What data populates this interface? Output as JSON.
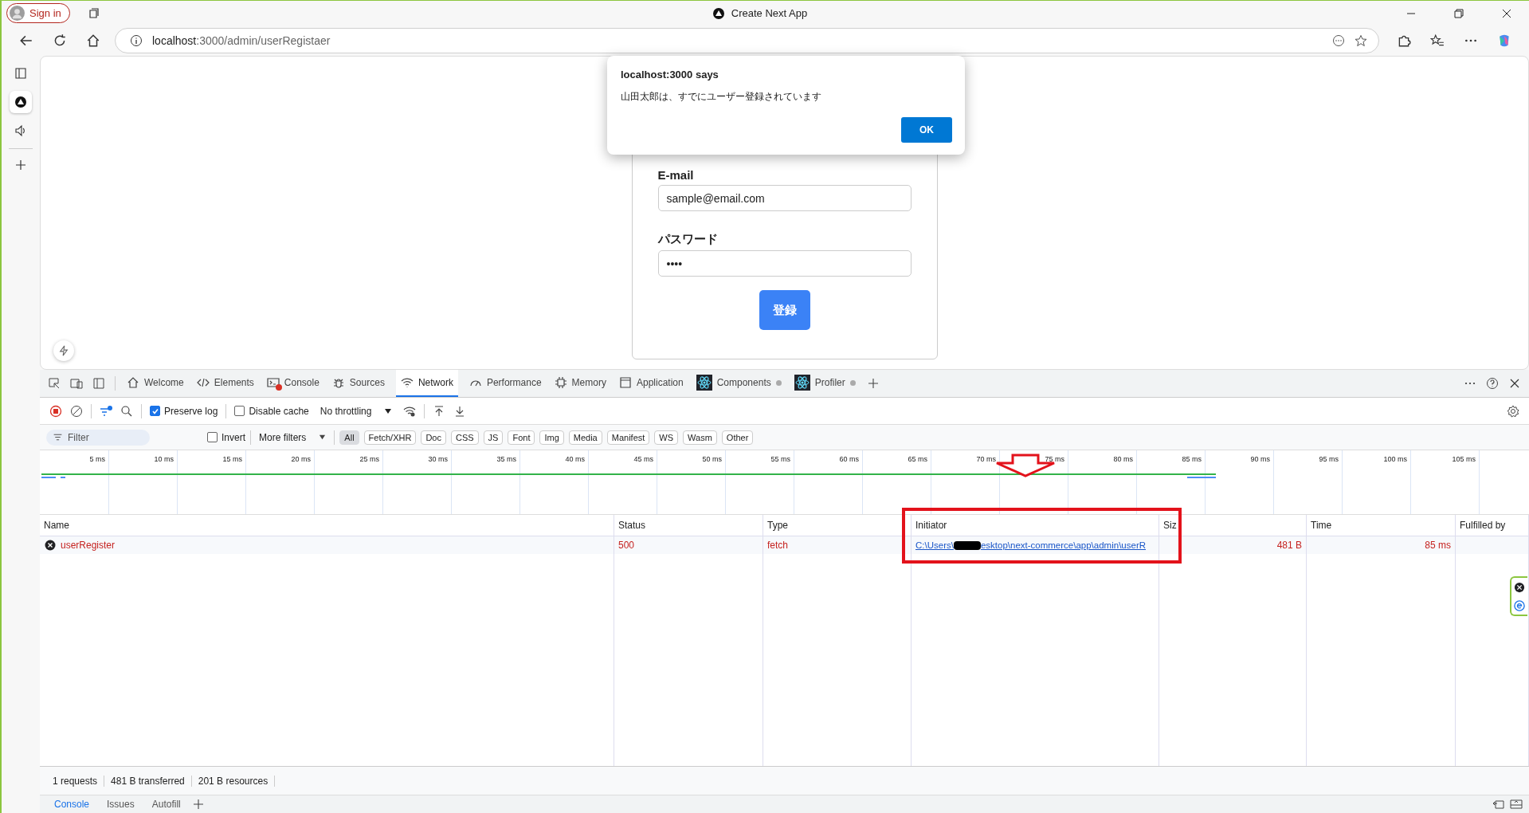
{
  "window": {
    "title": "Create Next App"
  },
  "profile": {
    "label": "Sign in"
  },
  "address": {
    "host": "localhost",
    "path": ":3000/admin/userRegistaer"
  },
  "sidebar": {
    "items": [
      {
        "selected": false
      },
      {
        "selected": true
      },
      {
        "selected": false
      }
    ]
  },
  "form": {
    "fields": [
      {
        "label": "E-mail",
        "value": "sample@email.com"
      },
      {
        "label": "パスワード",
        "value": "••••"
      }
    ],
    "submit": "登録"
  },
  "dialog": {
    "title": "localhost:3000 says",
    "message": "山田太郎は、すでにユーザー登録されています",
    "button": "OK"
  },
  "devtools": {
    "tabs": [
      {
        "label": "Welcome",
        "selected": false,
        "error_badge": false,
        "dot": false
      },
      {
        "label": "Elements",
        "selected": false,
        "error_badge": false,
        "dot": false
      },
      {
        "label": "Console",
        "selected": false,
        "error_badge": true,
        "dot": false
      },
      {
        "label": "Sources",
        "selected": false,
        "error_badge": false,
        "dot": false
      },
      {
        "label": "Network",
        "selected": true,
        "error_badge": false,
        "dot": false
      },
      {
        "label": "Performance",
        "selected": false,
        "error_badge": false,
        "dot": false
      },
      {
        "label": "Memory",
        "selected": false,
        "error_badge": false,
        "dot": false
      },
      {
        "label": "Application",
        "selected": false,
        "error_badge": false,
        "dot": false
      },
      {
        "label": "Components",
        "selected": false,
        "error_badge": false,
        "dot": true
      },
      {
        "label": "Profiler",
        "selected": false,
        "error_badge": false,
        "dot": true
      }
    ],
    "toolbar": {
      "preserve_log": {
        "label": "Preserve log",
        "checked": true
      },
      "disable_cache": {
        "label": "Disable cache",
        "checked": false
      },
      "throttling": "No throttling"
    },
    "filter": {
      "placeholder": "Filter",
      "invert": {
        "label": "Invert",
        "checked": false
      },
      "more_filters": "More filters",
      "types": [
        {
          "label": "All",
          "selected": true
        },
        {
          "label": "Fetch/XHR",
          "selected": false
        },
        {
          "label": "Doc",
          "selected": false
        },
        {
          "label": "CSS",
          "selected": false
        },
        {
          "label": "JS",
          "selected": false
        },
        {
          "label": "Font",
          "selected": false
        },
        {
          "label": "Img",
          "selected": false
        },
        {
          "label": "Media",
          "selected": false
        },
        {
          "label": "Manifest",
          "selected": false
        },
        {
          "label": "WS",
          "selected": false
        },
        {
          "label": "Wasm",
          "selected": false
        },
        {
          "label": "Other",
          "selected": false
        }
      ]
    },
    "timeline": {
      "ticks": [
        "5 ms",
        "10 ms",
        "15 ms",
        "20 ms",
        "25 ms",
        "30 ms",
        "35 ms",
        "40 ms",
        "45 ms",
        "50 ms",
        "55 ms",
        "60 ms",
        "65 ms",
        "70 ms",
        "75 ms",
        "80 ms",
        "85 ms",
        "90 ms",
        "95 ms",
        "100 ms",
        "105 ms"
      ]
    },
    "table": {
      "columns": [
        "Name",
        "Status",
        "Type",
        "Initiator",
        "Siz",
        "Time",
        "Fulfilled by"
      ],
      "rows": [
        {
          "name": "userRegister",
          "failed": true,
          "status": "500",
          "type": "fetch",
          "initiator": [
            "C:\\Users\\",
            "esktop\\next-commerce\\app\\admin\\userR"
          ],
          "size": "481 B",
          "time": "85 ms"
        }
      ]
    },
    "summary": [
      "1 requests",
      "481 B transferred",
      "201 B resources"
    ],
    "drawer_tabs": [
      {
        "label": "Console",
        "selected": true
      },
      {
        "label": "Issues",
        "selected": false
      },
      {
        "label": "Autofill",
        "selected": false
      }
    ]
  }
}
